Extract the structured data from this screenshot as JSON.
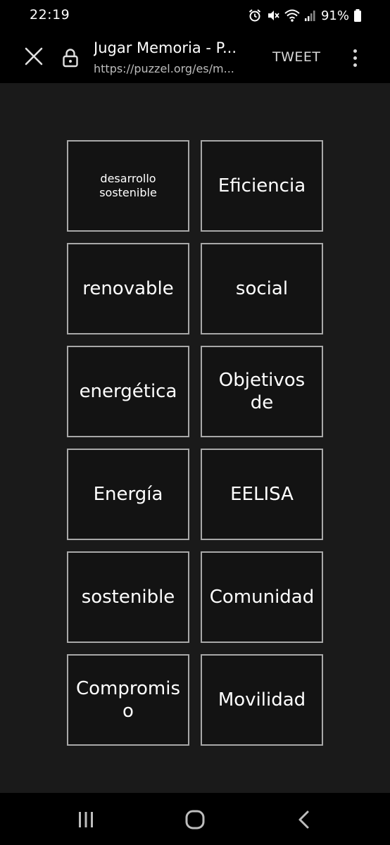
{
  "status_bar": {
    "time": "22:19",
    "battery": "91%",
    "icons": [
      "alarm-icon",
      "mute-icon",
      "wifi-icon",
      "signal-icon",
      "battery-icon"
    ]
  },
  "browser": {
    "title": "Jugar Memoria - P...",
    "url": "https://puzzel.org/es/m...",
    "tweet_label": "TWEET",
    "icons": [
      "close-icon",
      "lock-icon",
      "more-vertical-icon"
    ]
  },
  "cards": [
    {
      "text": "desarrollo sostenible"
    },
    {
      "text": "Eficiencia"
    },
    {
      "text": "renovable"
    },
    {
      "text": "social"
    },
    {
      "text": "energética"
    },
    {
      "text": "Objetivos de"
    },
    {
      "text": "Energía"
    },
    {
      "text": "EELISA"
    },
    {
      "text": "sostenible"
    },
    {
      "text": "Comunidad"
    },
    {
      "text": "Compromiso"
    },
    {
      "text": "Movilidad"
    }
  ],
  "nav_bar": {
    "icons": [
      "recent-apps-icon",
      "home-icon",
      "back-icon"
    ]
  },
  "colors": {
    "background": "#1a1a1a",
    "card_border": "#a8a8a8",
    "text": "#ffffff"
  }
}
